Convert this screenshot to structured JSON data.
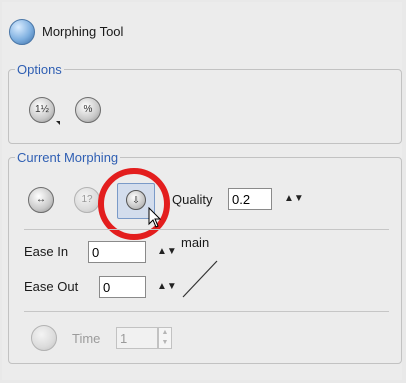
{
  "app": {
    "title": "Morphing Tool"
  },
  "options": {
    "legend": "Options",
    "tools": [
      {
        "icon": "numbered-morph-icon",
        "glyph": "1½"
      },
      {
        "icon": "morph-palette-icon",
        "glyph": "%"
      }
    ]
  },
  "current_morphing": {
    "legend": "Current Morphing",
    "tools": [
      {
        "icon": "morph-arrows-icon",
        "glyph": "↔"
      },
      {
        "icon": "morph-hint-icon",
        "glyph": "1?"
      },
      {
        "icon": "insert-frame-icon",
        "glyph": "⇩"
      }
    ],
    "quality": {
      "label": "Quality",
      "value": "0.2"
    },
    "ease_in": {
      "label": "Ease In",
      "value": "0"
    },
    "ease_out": {
      "label": "Ease Out",
      "value": "0"
    },
    "curve_label": "main",
    "time": {
      "label": "Time",
      "value": "1"
    }
  },
  "colors": {
    "accent": "#2f5fb3",
    "highlight_ring": "#e31e1e"
  }
}
